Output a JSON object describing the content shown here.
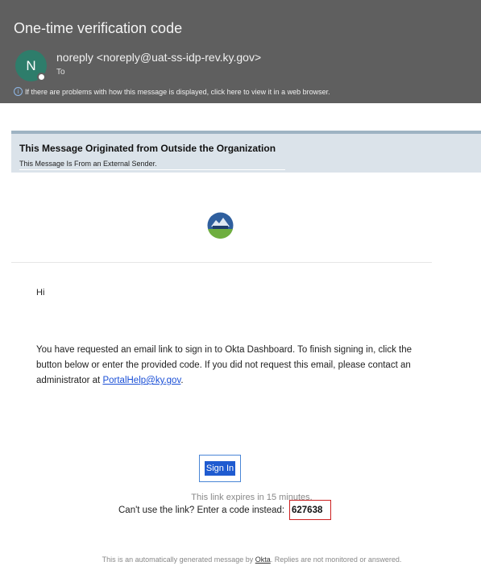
{
  "header": {
    "subject": "One-time verification code",
    "avatar_initial": "N",
    "sender": "noreply <noreply@uat-ss-idp-rev.ky.gov>",
    "to_label": "To",
    "info_text": "If there are problems with how this message is displayed, click here to view it in a web browser."
  },
  "external_banner": {
    "title": "This Message Originated from Outside the Organization",
    "subtitle": "This Message Is From an External Sender."
  },
  "email": {
    "greeting": "Hi",
    "body_before_link": "You have requested an email link to sign in to Okta Dashboard. To finish signing in, click the button below or enter the provided code. If you did not request this email, please contact an administrator at ",
    "link_text": "PortalHelp@ky.gov",
    "body_after_link": ".",
    "signin_label": "Sign In",
    "expires_text": "This link expires in 15 minutes.",
    "code_prompt": "Can't use the link? Enter a code instead: ",
    "code": "627638",
    "footer_before": "This is an automatically generated message by ",
    "footer_brand": "Okta",
    "footer_after": ". Replies are not monitored or answered."
  },
  "colors": {
    "header_bg": "#5f5f5f",
    "avatar": "#2e7d6b",
    "banner_bg": "#dbe3ea",
    "signin_button": "#1f5bd0",
    "code_highlight_border": "#cc2020"
  },
  "icons": {
    "info": "info-icon",
    "logo": "kyccr-logo"
  }
}
